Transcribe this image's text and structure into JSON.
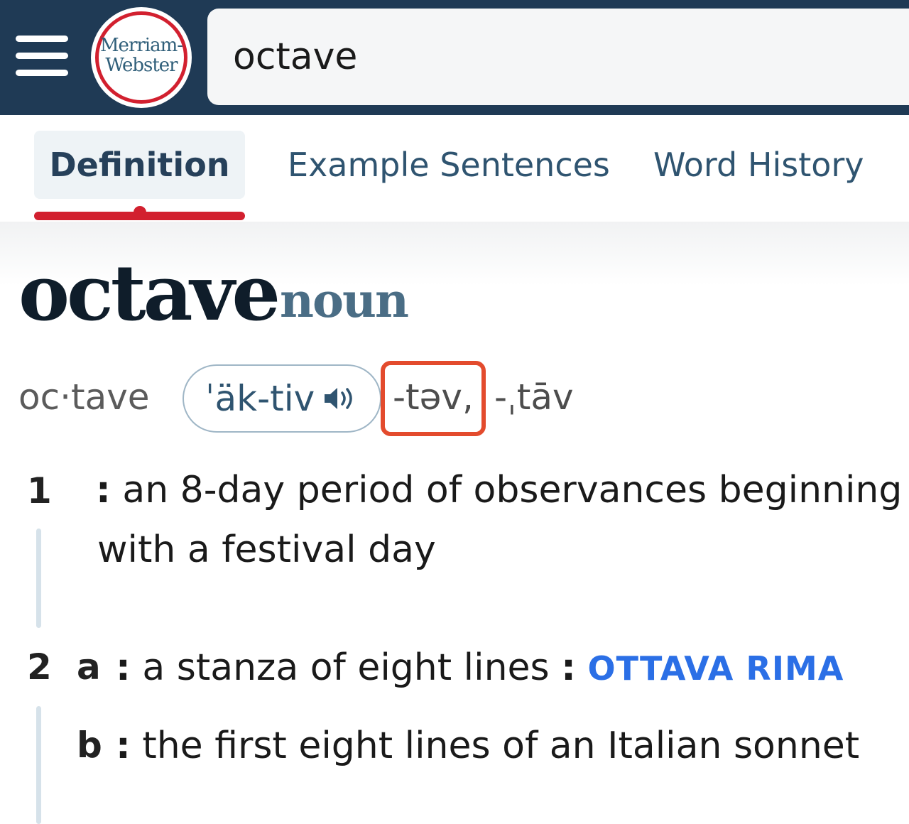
{
  "header": {
    "logo_line1": "Merriam-",
    "logo_line2": "Webster",
    "search_value": "octave"
  },
  "tabs": [
    {
      "label": "Definition"
    },
    {
      "label": "Example Sentences"
    },
    {
      "label": "Word History"
    }
  ],
  "entry": {
    "headword": "octave",
    "part_of_speech": "noun",
    "syllables": "oc·tave",
    "pronunciation": "ˈäk-tiv",
    "pron_variant_1": "-təv,",
    "pron_variant_2": "-ˌtāv"
  },
  "senses": {
    "s1": {
      "number": "1",
      "colon": ":",
      "line1": " an 8-day period of observances beginning",
      "line2": "with a festival day"
    },
    "s2": {
      "number": "2",
      "a": {
        "letter": "a",
        "colon": ":",
        "text": " a stanza of eight lines ",
        "colon2": ":",
        "xref": "OTTAVA RIMA"
      },
      "b": {
        "letter": "b",
        "colon": ":",
        "text": " the first eight lines of an Italian sonnet"
      }
    }
  },
  "colors": {
    "header_bg": "#1f3a55",
    "accent_red": "#d2202f",
    "link_blue": "#2b6fe6",
    "highlight": "#e34b2d"
  }
}
